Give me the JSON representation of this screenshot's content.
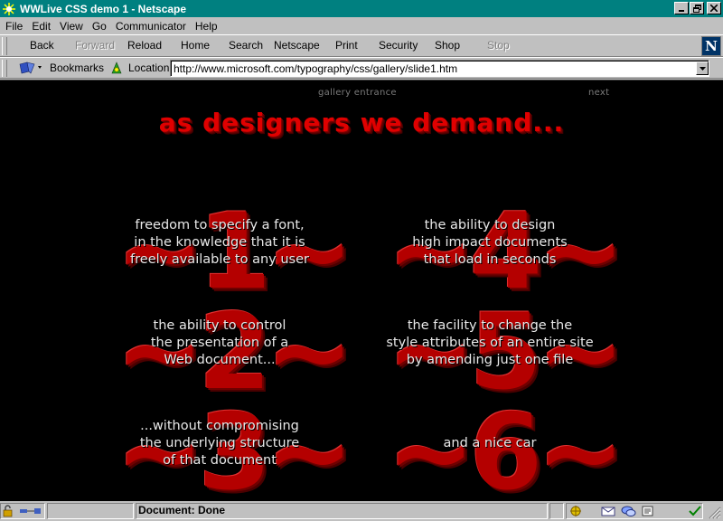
{
  "window": {
    "title": "WWLive CSS demo 1 - Netscape",
    "buttons": [
      "minimize",
      "maximize",
      "close"
    ]
  },
  "menu": {
    "items": [
      {
        "label": "File"
      },
      {
        "label": "Edit"
      },
      {
        "label": "View"
      },
      {
        "label": "Go"
      },
      {
        "label": "Communicator"
      },
      {
        "label": "Help"
      }
    ]
  },
  "toolbar": {
    "buttons": [
      {
        "label": "Back",
        "enabled": true
      },
      {
        "label": "Forward",
        "enabled": false
      },
      {
        "label": "Reload",
        "enabled": true
      },
      {
        "label": "Home",
        "enabled": true
      },
      {
        "label": "Search",
        "enabled": true
      },
      {
        "label": "Netscape",
        "enabled": true
      },
      {
        "label": "Print",
        "enabled": true
      },
      {
        "label": "Security",
        "enabled": true
      },
      {
        "label": "Shop",
        "enabled": true
      },
      {
        "label": "Stop",
        "enabled": false
      }
    ],
    "logo_letter": "N"
  },
  "location": {
    "bookmarks_label": "Bookmarks",
    "location_label": "Location:",
    "url": "http://www.microsoft.com/typography/css/gallery/slide1.htm"
  },
  "page": {
    "nav": {
      "entrance": "gallery entrance",
      "next": "next"
    },
    "headline": "as designers we demand...",
    "items": [
      {
        "number": "~1~",
        "lines": [
          "freedom to specify a font,",
          "in the knowledge that it is",
          "freely available to any user"
        ]
      },
      {
        "number": "~4~",
        "lines": [
          "the ability to design",
          "high impact documents",
          "that load in seconds"
        ]
      },
      {
        "number": "~2~",
        "lines": [
          "the ability to control",
          "the presentation of a",
          "Web document..."
        ]
      },
      {
        "number": "~5~",
        "lines": [
          "the facility to change the",
          "style attributes of an entire site",
          "by amending just one file"
        ]
      },
      {
        "number": "~3~",
        "lines": [
          "...without compromising",
          "the underlying structure",
          "of that document"
        ]
      },
      {
        "number": "~6~",
        "lines": [
          "and a nice car"
        ]
      }
    ]
  },
  "status": {
    "text": "Document: Done"
  },
  "colors": {
    "titlebar": "#008080",
    "chrome": "#c0c0c0",
    "content_bg": "#000000",
    "accent_red": "#cc0000",
    "body_text": "#e8e8e8"
  }
}
